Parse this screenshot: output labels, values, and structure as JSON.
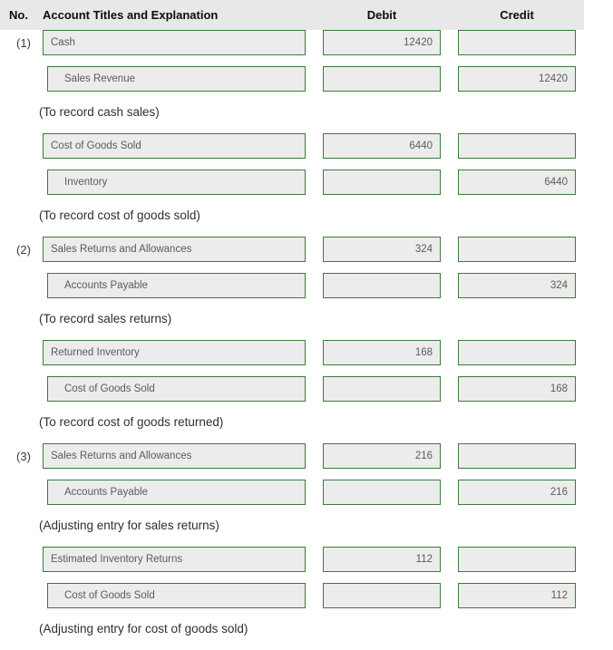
{
  "header": {
    "no": "No.",
    "account": "Account Titles and Explanation",
    "debit": "Debit",
    "credit": "Credit"
  },
  "colors": {
    "field_border": "#3c7a3c",
    "field_fill": "#ececec",
    "header_fill": "#e8e8e8",
    "field_text": "#5b5b5b",
    "explanation_text": "#2f2f2f"
  },
  "rows": [
    {
      "kind": "entry",
      "no": "(1)",
      "account": "Cash",
      "indent": false,
      "debit": "12420",
      "credit": ""
    },
    {
      "kind": "entry",
      "no": "",
      "account": "Sales Revenue",
      "indent": true,
      "debit": "",
      "credit": "12420"
    },
    {
      "kind": "explanation",
      "text": "(To record cash sales)"
    },
    {
      "kind": "entry",
      "no": "",
      "account": "Cost of Goods Sold",
      "indent": false,
      "debit": "6440",
      "credit": ""
    },
    {
      "kind": "entry",
      "no": "",
      "account": "Inventory",
      "indent": true,
      "debit": "",
      "credit": "6440"
    },
    {
      "kind": "explanation",
      "text": "(To record cost of goods sold)"
    },
    {
      "kind": "entry",
      "no": "(2)",
      "account": "Sales Returns and Allowances",
      "indent": false,
      "debit": "324",
      "credit": ""
    },
    {
      "kind": "entry",
      "no": "",
      "account": "Accounts Payable",
      "indent": true,
      "debit": "",
      "credit": "324"
    },
    {
      "kind": "explanation",
      "text": "(To record sales returns)"
    },
    {
      "kind": "entry",
      "no": "",
      "account": "Returned Inventory",
      "indent": false,
      "debit": "168",
      "credit": ""
    },
    {
      "kind": "entry",
      "no": "",
      "account": "Cost of Goods Sold",
      "indent": true,
      "debit": "",
      "credit": "168"
    },
    {
      "kind": "explanation",
      "text": "(To record cost of goods returned)"
    },
    {
      "kind": "entry",
      "no": "(3)",
      "account": "Sales Returns and Allowances",
      "indent": false,
      "debit": "216",
      "credit": ""
    },
    {
      "kind": "entry",
      "no": "",
      "account": "Accounts Payable",
      "indent": true,
      "debit": "",
      "credit": "216"
    },
    {
      "kind": "explanation",
      "text": "(Adjusting entry for sales returns)"
    },
    {
      "kind": "entry",
      "no": "",
      "account": "Estimated Inventory Returns",
      "indent": false,
      "debit": "112",
      "credit": ""
    },
    {
      "kind": "entry",
      "no": "",
      "account": "Cost of Goods Sold",
      "indent": true,
      "debit": "",
      "credit": "112"
    },
    {
      "kind": "explanation",
      "text": "(Adjusting entry for cost of goods sold)"
    }
  ]
}
